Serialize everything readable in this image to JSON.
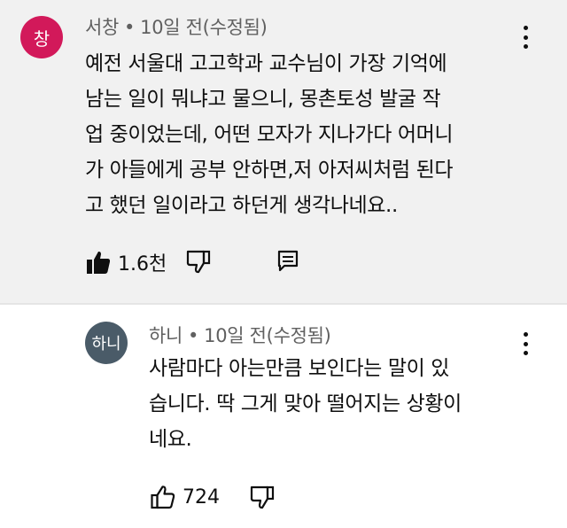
{
  "comment1": {
    "avatar_text": "창",
    "avatar_color": "#d2195a",
    "author": "서창",
    "separator": "•",
    "timestamp": "10일 전(수정됨)",
    "lines": [
      "예전 서울대 고고학과 교수님이 가장 기억에",
      "남는 일이 뭐냐고 물으니, 몽촌토성 발굴 작",
      "업 중이었는데, 어떤 모자가 지나가다 어머니",
      "가 아들에게 공부 안하면,저 아저씨처럼 된다",
      "고 했던 일이라고 하던게 생각나네요.."
    ],
    "like_count": "1.6천",
    "icons": {
      "like": "thumbs-up-filled-icon",
      "dislike": "thumbs-down-icon",
      "reply": "reply-comment-icon",
      "more": "more-vertical-icon"
    }
  },
  "comment2": {
    "avatar_text": "하니",
    "avatar_color": "#4a5b68",
    "author": "하니",
    "separator": "•",
    "timestamp": "10일 전(수정됨)",
    "lines": [
      "사람마다 아는만큼 보인다는 말이 있",
      "습니다. 딱 그게 맞아 떨어지는 상황이",
      "네요."
    ],
    "like_count": "724",
    "icons": {
      "like": "thumbs-up-outline-icon",
      "dislike": "thumbs-down-icon",
      "more": "more-vertical-icon"
    }
  },
  "colors": {
    "top_comment_bg": "#f1f1f1",
    "meta_text": "#606060"
  }
}
